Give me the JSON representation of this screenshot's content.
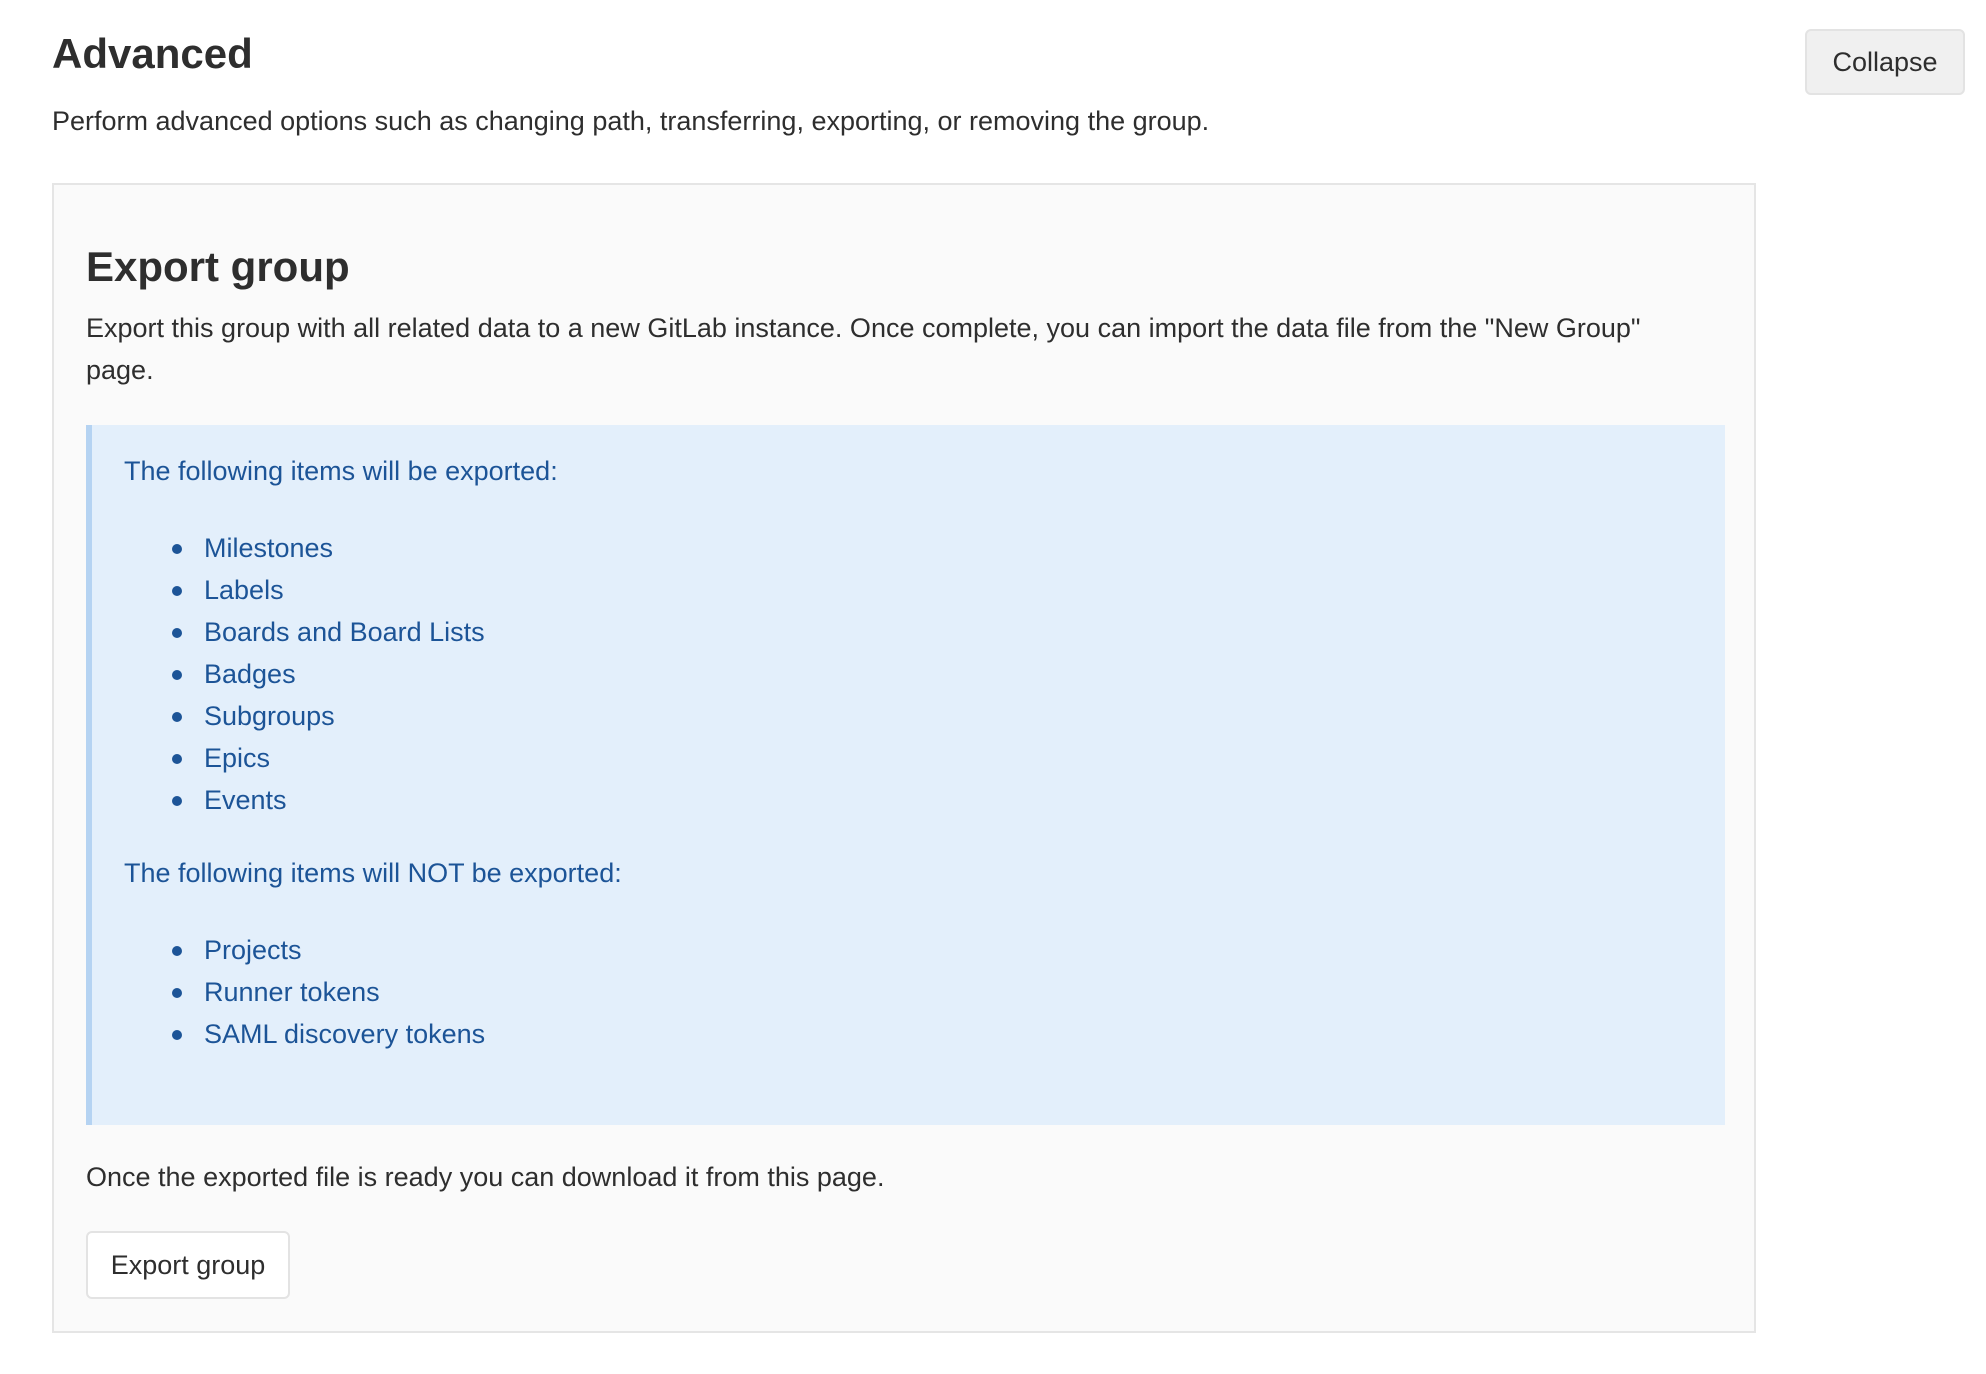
{
  "section": {
    "title": "Advanced",
    "description": "Perform advanced options such as changing path, transferring, exporting, or removing the group.",
    "collapse_label": "Collapse"
  },
  "export_panel": {
    "title": "Export group",
    "description": "Export this group with all related data to a new GitLab instance. Once complete, you can import the data file from the \"New Group\" page.",
    "info": {
      "exported_heading": "The following items will be exported:",
      "exported_items": [
        "Milestones",
        "Labels",
        "Boards and Board Lists",
        "Badges",
        "Subgroups",
        "Epics",
        "Events"
      ],
      "not_exported_heading": "The following items will NOT be exported:",
      "not_exported_items": [
        "Projects",
        "Runner tokens",
        "SAML discovery tokens"
      ]
    },
    "ready_text": "Once the exported file is ready you can download it from this page.",
    "export_button_label": "Export group"
  },
  "colors": {
    "info_background": "#e3effb",
    "info_border": "#b5d3f2",
    "info_text": "#1c5497",
    "panel_background": "#fafafa"
  }
}
